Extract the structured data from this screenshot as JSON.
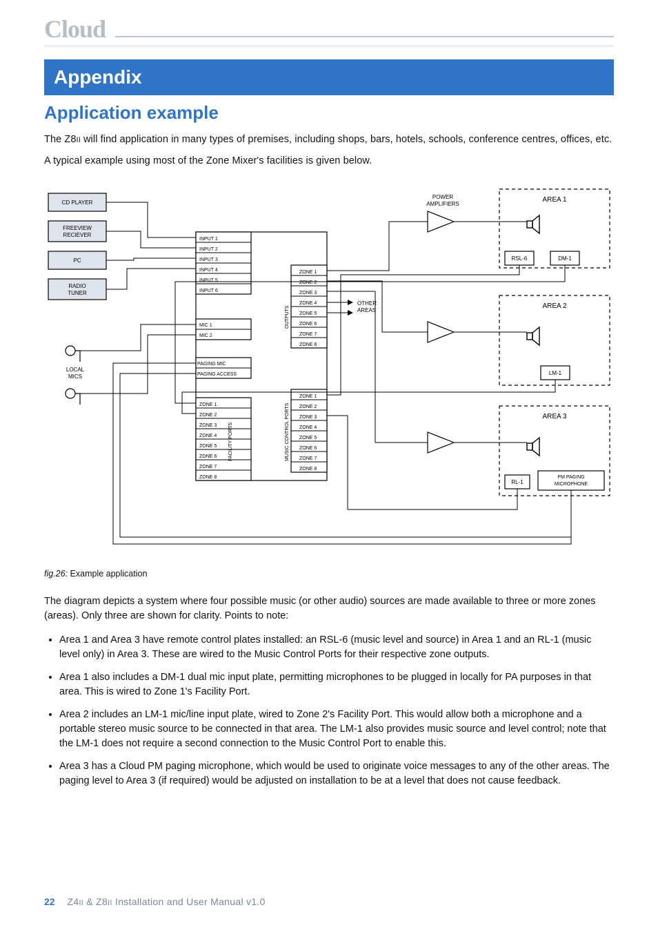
{
  "brand": "Cloud",
  "section_bar": "Appendix",
  "subhead": "Application example",
  "intro_p1_a": "The Z8",
  "intro_p1_small": "II",
  "intro_p1_b": " will find application in many types of premises, including shops, bars, hotels, schools, conference centres, offices, etc.",
  "intro_p2": "A typical example using most of the Zone Mixer's facilities is given below.",
  "caption_fig": "fig.26:",
  "caption_text": " Example application",
  "para_lead": "The diagram depicts a system where four possible music (or other audio) sources are made available to three or more zones (areas). Only three are shown for clarity. Points to note:",
  "bullets": [
    "Area 1 and Area 3 have remote control plates installed: an RSL-6 (music level and source) in Area 1 and an RL-1 (music level only) in Area 3. These are wired to the Music Control Ports for their respective zone outputs.",
    "Area 1 also includes a DM-1 dual mic input plate, permitting microphones to be plugged in locally for PA purposes in that area. This is wired to Zone 1's Facility Port.",
    "Area 2 includes an LM-1 mic/line input plate, wired to Zone 2's Facility Port. This would allow both a microphone and a portable stereo music source to be connected in that area. The LM-1 also provides music source and level control; note that the LM-1 does not require a second connection to the Music Control Port to enable this.",
    "Area 3 has a Cloud PM paging microphone, which would be used to originate voice messages to any of the other areas. The paging level to Area 3 (if required) would be adjusted on installation to be at a level that does not cause feedback."
  ],
  "footer_page": "22",
  "footer_doc_a": "Z4",
  "footer_doc_small1": "II",
  "footer_doc_b": " & Z8",
  "footer_doc_small2": "II",
  "footer_doc_c": " Installation and User Manual v1.0",
  "diagram": {
    "sources": [
      "CD PLAYER",
      "FREEVIEW RECIEVER",
      "PC",
      "RADIO TUNER"
    ],
    "local_mics": "LOCAL\nMICS",
    "inputs": [
      "INPUT 1",
      "INPUT 2",
      "INPUT 3",
      "INPUT 4",
      "INPUT 5",
      "INPUT 6"
    ],
    "mics": [
      "MIC 1",
      "MIC 2"
    ],
    "paging_mic": "PAGING MIC",
    "paging_access": "PAGING ACCESS",
    "facility_zones": [
      "ZONE 1",
      "ZONE 2",
      "ZONE 3",
      "ZONE 4",
      "ZONE 5",
      "ZONE 6",
      "ZONE 7",
      "ZONE 8"
    ],
    "facility_label": "FACILITY PORTS",
    "outputs_zones": [
      "ZONE 1",
      "ZONE 2",
      "ZONE 3",
      "ZONE 4",
      "ZONE 5",
      "ZONE 6",
      "ZONE 7",
      "ZONE 8"
    ],
    "outputs_label": "OUTPUTS",
    "mcp_zones": [
      "ZONE 1",
      "ZONE 2",
      "ZONE 3",
      "ZONE 4",
      "ZONE 5",
      "ZONE 6",
      "ZONE 7",
      "ZONE 8"
    ],
    "mcp_label": "MUSIC CONTROL PORTS",
    "power_amp": "POWER\nAMPLIFIERS",
    "other_areas": "OTHER\nAREAS",
    "areas": [
      "AREA 1",
      "AREA 2",
      "AREA 3"
    ],
    "plates": {
      "rsl6": "RSL-6",
      "dm1": "DM-1",
      "lm1": "LM-1",
      "rl1": "RL-1",
      "pm": "PM PAGING\nMICROPHONE"
    }
  }
}
